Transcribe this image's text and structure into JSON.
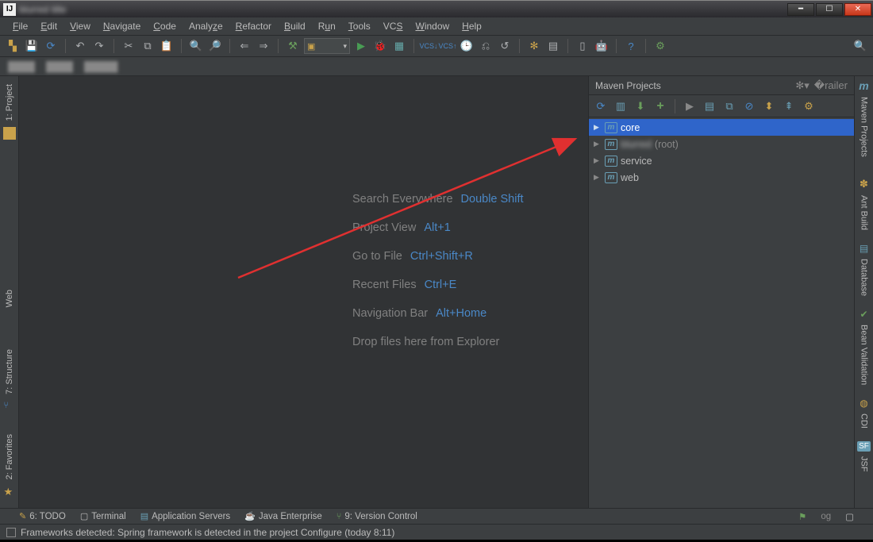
{
  "window": {
    "app_icon": "IJ"
  },
  "menu": [
    "File",
    "Edit",
    "View",
    "Navigate",
    "Code",
    "Analyze",
    "Refactor",
    "Build",
    "Run",
    "Tools",
    "VCS",
    "Window",
    "Help"
  ],
  "left_tabs": {
    "project": "1: Project",
    "web": "Web",
    "structure": "7: Structure",
    "favorites": "2: Favorites"
  },
  "right_tabs": {
    "maven": "Maven Projects",
    "ant": "Ant Build",
    "database": "Database",
    "bean": "Bean Validation",
    "cdi": "CDI",
    "jsf": "JSF"
  },
  "welcome": [
    {
      "label": "Search Everywhere",
      "shortcut": "Double Shift"
    },
    {
      "label": "Project View",
      "shortcut": "Alt+1"
    },
    {
      "label": "Go to File",
      "shortcut": "Ctrl+Shift+R"
    },
    {
      "label": "Recent Files",
      "shortcut": "Ctrl+E"
    },
    {
      "label": "Navigation Bar",
      "shortcut": "Alt+Home"
    },
    {
      "label": "Drop files here from Explorer",
      "shortcut": ""
    }
  ],
  "maven": {
    "title": "Maven Projects",
    "items": [
      {
        "name": "core",
        "suffix": "",
        "selected": true
      },
      {
        "name": "",
        "suffix": "(root)",
        "selected": false,
        "blurred": true
      },
      {
        "name": "service",
        "suffix": "",
        "selected": false
      },
      {
        "name": "web",
        "suffix": "",
        "selected": false
      }
    ]
  },
  "bottom_tabs": {
    "todo": "6: TODO",
    "terminal": "Terminal",
    "appservers": "Application Servers",
    "javaee": "Java Enterprise",
    "vcs": "9: Version Control"
  },
  "status": {
    "message": "Frameworks detected: Spring framework is detected in the project Configure (today 8:11)",
    "tail": "og"
  }
}
